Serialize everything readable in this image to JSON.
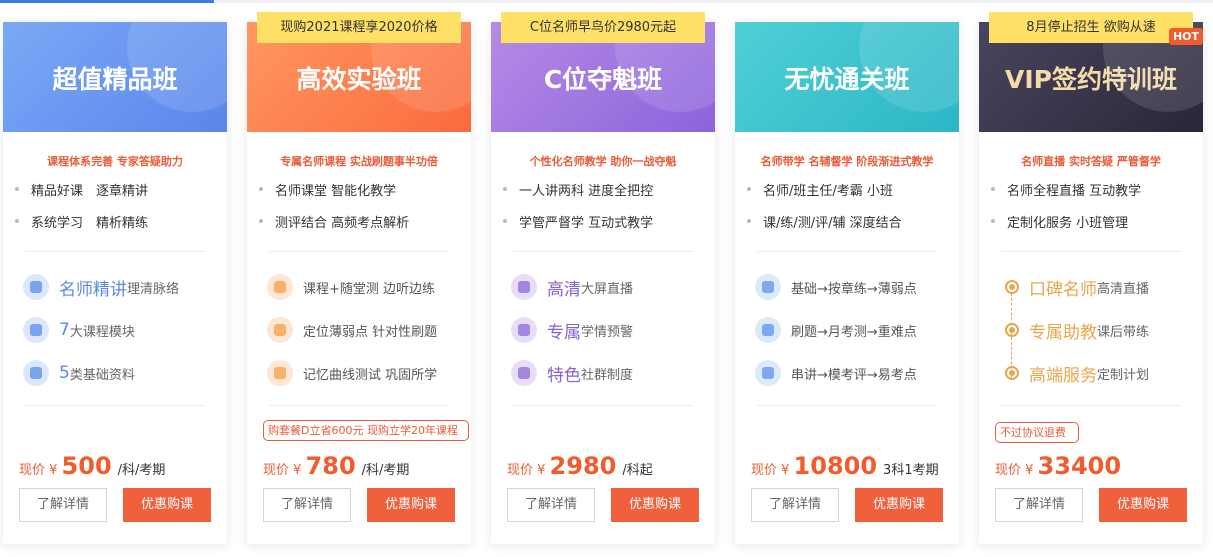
{
  "colors": {
    "accent": "#f0603c",
    "tab_active": "#3a7be8"
  },
  "cards": [
    {
      "title": "超值精品班",
      "ribbon": "",
      "slogan": "课程体系完善 专家答疑助力",
      "features": [
        "精品好课　逐章精讲",
        "系统学习　精析精练"
      ],
      "highlights": [
        {
          "icon": "user-icon",
          "big": "名师精讲",
          "small": "理清脉络"
        },
        {
          "icon": "book-icon",
          "big": "7",
          "small": "大课程模块"
        },
        {
          "icon": "heart-icon",
          "big": "5",
          "small": "类基础资料"
        }
      ],
      "promo": "",
      "price_label": "现价 ¥",
      "price": "500",
      "price_unit": "/科/考期",
      "detail_button": "了解详情",
      "buy_button": "优惠购课"
    },
    {
      "title": "高效实验班",
      "ribbon": "现购2021课程享2020价格",
      "slogan": "专属名师课程 实战刷题事半功倍",
      "features": [
        "名师课堂 智能化教学",
        "测评结合 高频考点解析"
      ],
      "highlights": [
        {
          "icon": "user-icon",
          "big": "",
          "small": "课程+随堂测 边听边练"
        },
        {
          "icon": "book-icon",
          "big": "",
          "small": "定位薄弱点 针对性刷题"
        },
        {
          "icon": "heart-icon",
          "big": "",
          "small": "记忆曲线测试 巩固所学"
        }
      ],
      "promo": "购套餐D立省600元 现购立学20年课程",
      "price_label": "现价 ¥",
      "price": "780",
      "price_unit": "/科/考期",
      "detail_button": "了解详情",
      "buy_button": "优惠购课"
    },
    {
      "title": "C位夺魁班",
      "ribbon": "C位名师早鸟价2980元起",
      "slogan": "个性化名师教学 助你一战夺魁",
      "features": [
        "一人讲两科 进度全把控",
        "学管严督学 互动式教学"
      ],
      "highlights": [
        {
          "icon": "user-icon",
          "big": "高清",
          "small": "大屏直播"
        },
        {
          "icon": "book-icon",
          "big": "专属",
          "small": "学情预警"
        },
        {
          "icon": "heart-icon",
          "big": "特色",
          "small": "社群制度"
        }
      ],
      "promo": "",
      "price_label": "现价 ¥",
      "price": "2980",
      "price_unit": "/科起",
      "detail_button": "了解详情",
      "buy_button": "优惠购课"
    },
    {
      "title": "无忧通关班",
      "ribbon": "",
      "slogan": "名师带学 名辅督学 阶段渐进式教学",
      "features": [
        "名师/班主任/考霸 小班",
        "课/练/测/评/辅 深度结合"
      ],
      "highlights": [
        {
          "icon": "user-icon",
          "big": "",
          "small": "基础→按章练→薄弱点"
        },
        {
          "icon": "user-icon",
          "big": "",
          "small": "刷题→月考测→重难点"
        },
        {
          "icon": "user-icon",
          "big": "",
          "small": "串讲→模考评→易考点"
        }
      ],
      "promo": "",
      "price_label": "现价 ¥",
      "price": "10800",
      "price_unit": "3科1考期",
      "detail_button": "了解详情",
      "buy_button": "优惠购课"
    },
    {
      "title": "VIP签约特训班",
      "ribbon": "8月停止招生 欲购从速",
      "hot": "HOT",
      "slogan": "名师直播 实时答疑 严管督学",
      "features": [
        "名师全程直播 互动教学",
        "定制化服务 小班管理"
      ],
      "highlights": [
        {
          "icon": "dot-icon",
          "big": "口碑名师",
          "small": "高清直播"
        },
        {
          "icon": "dot-icon",
          "big": "专属助教",
          "small": "课后带练"
        },
        {
          "icon": "dot-icon",
          "big": "高端服务",
          "small": "定制计划"
        }
      ],
      "promo": "不过协议退费",
      "price_label": "现价 ¥",
      "price": "33400",
      "price_unit": "",
      "detail_button": "了解详情",
      "buy_button": "优惠购课"
    }
  ]
}
